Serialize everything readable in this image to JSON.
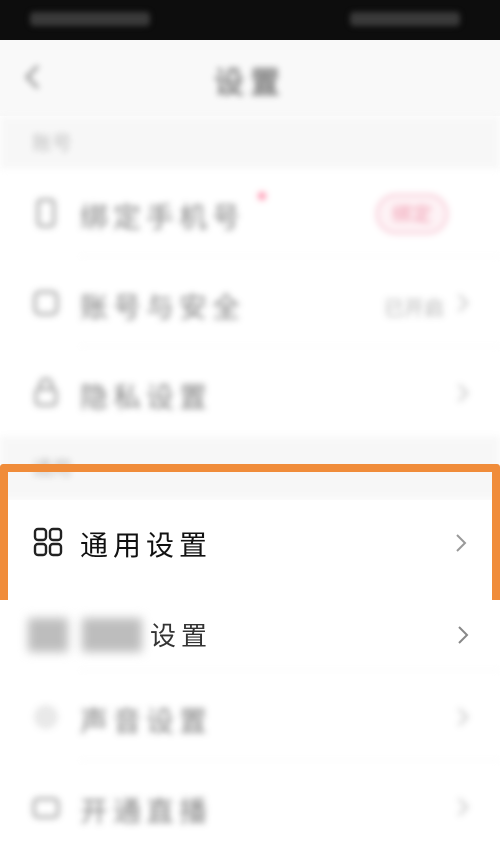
{
  "nav": {
    "title": "设置"
  },
  "sections": {
    "account": {
      "header": "账号"
    },
    "general": {
      "header": "通用"
    }
  },
  "rows": {
    "bind_phone": {
      "label": "绑定手机号",
      "badge": "绑定"
    },
    "account_security": {
      "label": "账号与安全",
      "value": "已开启"
    },
    "privacy": {
      "label": "隐私设置"
    },
    "general_settings": {
      "label": "通用设置"
    },
    "notification_settings": {
      "label": "设置"
    },
    "row_7": {
      "label": "声音设置"
    },
    "row_8": {
      "label": "开通直播"
    }
  },
  "colors": {
    "highlight": "#f08c3a",
    "badge_text": "#e5486e",
    "badge_border": "#f28aa5",
    "status_bar": "#0d0d0d"
  },
  "icons": {
    "general_settings": "grid-icon",
    "chevron": "chevron-right-icon",
    "back": "back-arrow-icon"
  }
}
